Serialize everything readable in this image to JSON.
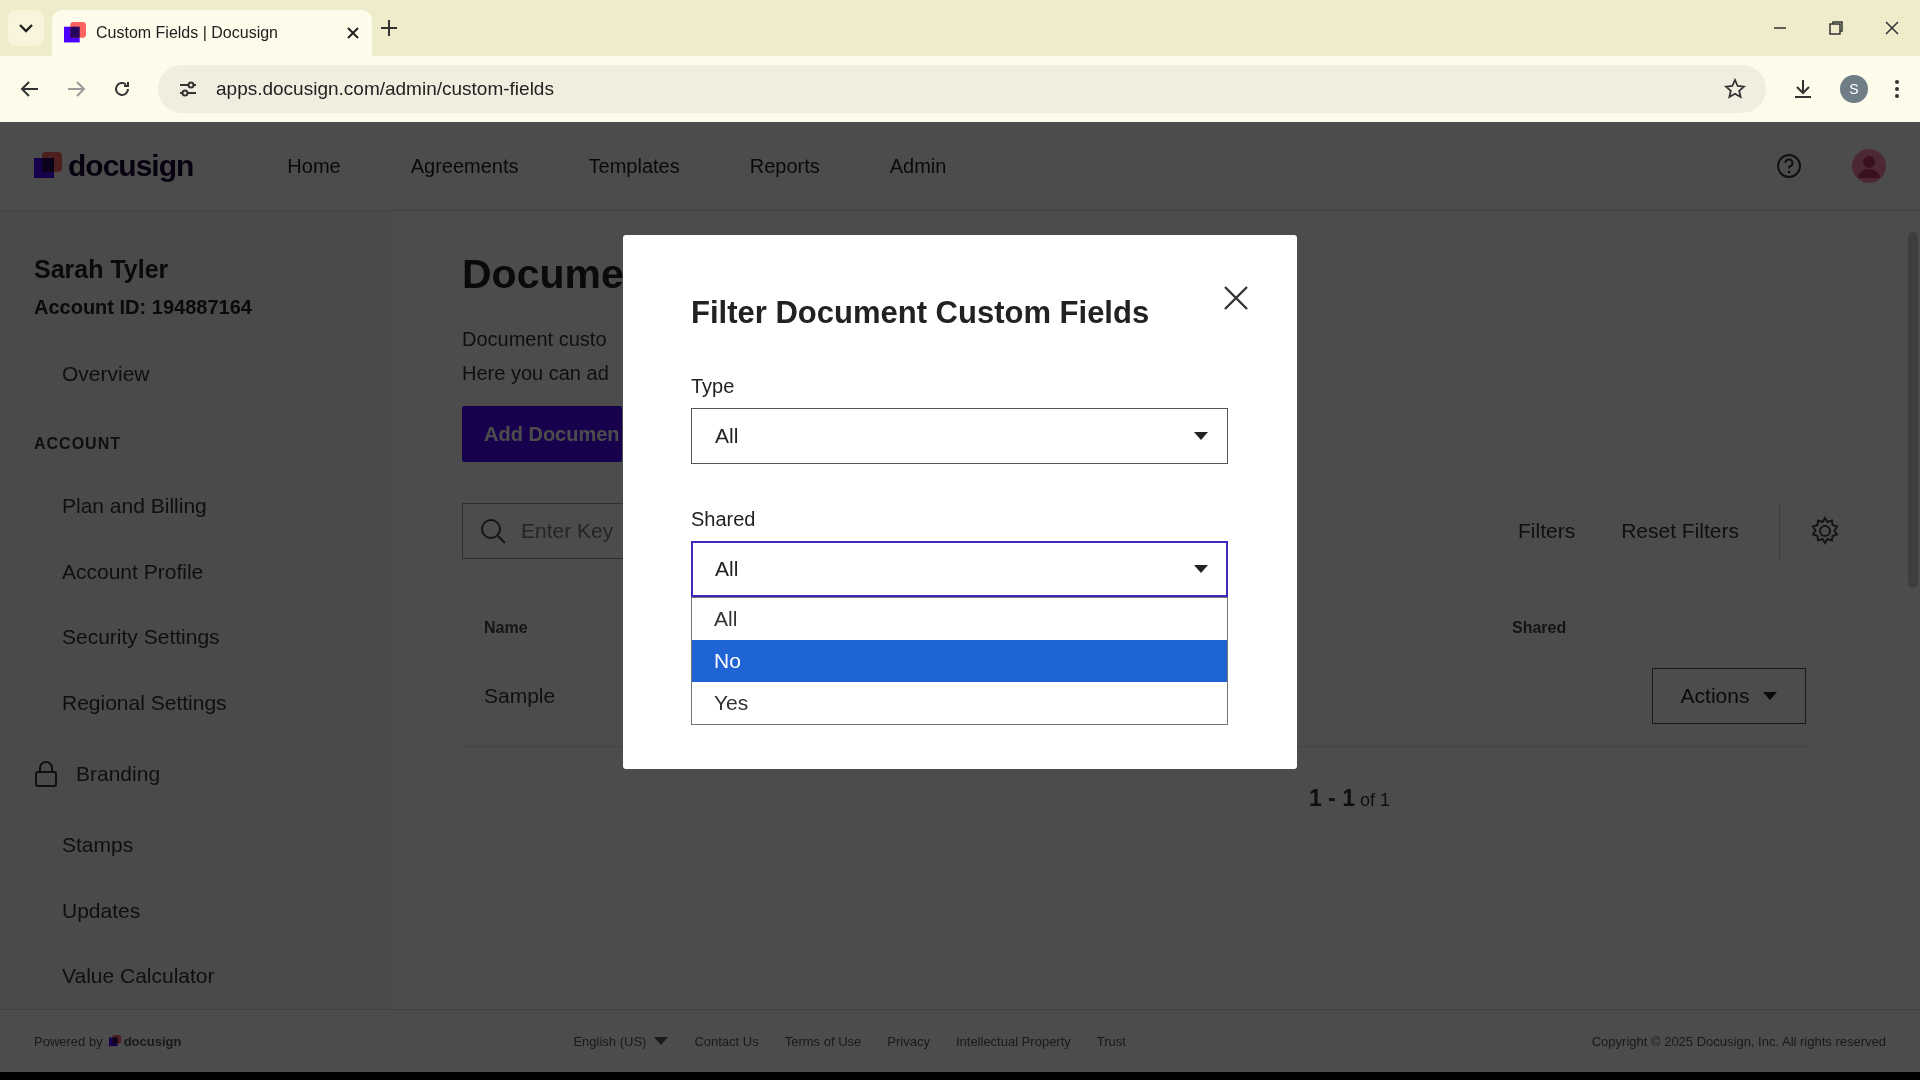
{
  "browser": {
    "tabs": [
      {
        "title": "Custom Fields | Docusign",
        "selected": true
      }
    ],
    "url": "apps.docusign.com/admin/custom-fields",
    "profile_initial": "S"
  },
  "header": {
    "logo": "docusign",
    "nav": [
      "Home",
      "Agreements",
      "Templates",
      "Reports",
      "Admin"
    ]
  },
  "sidebar": {
    "user_name": "Sarah Tyler",
    "account_id": "Account ID: 194887164",
    "items": [
      {
        "label": "Overview",
        "kind": "link"
      },
      {
        "label": "ACCOUNT",
        "kind": "section"
      },
      {
        "label": "Plan and Billing",
        "kind": "link"
      },
      {
        "label": "Account Profile",
        "kind": "link"
      },
      {
        "label": "Security Settings",
        "kind": "link"
      },
      {
        "label": "Regional Settings",
        "kind": "link"
      },
      {
        "label": "Branding",
        "kind": "locked"
      },
      {
        "label": "Stamps",
        "kind": "link"
      },
      {
        "label": "Updates",
        "kind": "link"
      },
      {
        "label": "Value Calculator",
        "kind": "link"
      }
    ]
  },
  "main": {
    "title": "Docume",
    "description": [
      "Document custo",
      "Here you can ad"
    ],
    "add_button": "Add Documen",
    "search": {
      "placeholder": "Enter Key"
    },
    "filters": [
      "Filters",
      "Reset Filters"
    ],
    "table": {
      "columns": [
        "Name",
        "Shared"
      ],
      "rows": [
        {
          "name": "Sample",
          "action": "Actions"
        }
      ]
    },
    "pagination": "**1 - 1** of 1"
  },
  "modal": {
    "title": "Filter Document Custom Fields",
    "fields": [
      {
        "label": "Type",
        "value": "All",
        "open": false
      },
      {
        "label": "Shared",
        "value": "All",
        "open": true,
        "options": [
          {
            "label": "All",
            "highlighted": false
          },
          {
            "label": "No",
            "highlighted": true
          },
          {
            "label": "Yes",
            "highlighted": false
          }
        ]
      }
    ]
  },
  "footer": {
    "powered_by": "Powered by",
    "logo": "docusign",
    "language": "English (US)",
    "links": [
      "Contact Us",
      "Terms of Use",
      "Privacy",
      "Intellectual Property",
      "Trust"
    ],
    "copyright": "Copyright © 2025 Docusign, Inc. All rights reserved"
  }
}
